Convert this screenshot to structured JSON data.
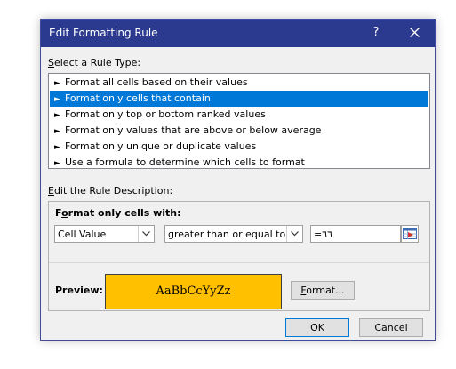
{
  "dialog": {
    "title": "Edit Formatting Rule",
    "help_glyph": "?",
    "close_glyph": "✕"
  },
  "rule_type": {
    "label_first": "S",
    "label_rest": "elect a Rule Type:",
    "items": [
      {
        "label": "Format all cells based on their values",
        "selected": false
      },
      {
        "label": "Format only cells that contain",
        "selected": true
      },
      {
        "label": "Format only top or bottom ranked values",
        "selected": false
      },
      {
        "label": "Format only values that are above or below average",
        "selected": false
      },
      {
        "label": "Format only unique or duplicate values",
        "selected": false
      },
      {
        "label": "Use a formula to determine which cells to format",
        "selected": false
      }
    ],
    "bullet": "►"
  },
  "description": {
    "label_first": "E",
    "label_rest": "dit the Rule Description:",
    "heading_first": "F",
    "heading_mid": "o",
    "heading_rest": "rmat only cells with:",
    "condition_type": "Cell Value",
    "operator": "greater than or equal to",
    "value": "=٦٦"
  },
  "preview": {
    "label": "Preview:",
    "sample_text": "AaBbCcYyZz",
    "format_button_first": "F",
    "format_button_rest": "ormat...",
    "fill_color": "#ffc000"
  },
  "buttons": {
    "ok": "OK",
    "cancel": "Cancel"
  },
  "colors": {
    "title_bar": "#2b3a8f",
    "selection": "#0078d7"
  }
}
